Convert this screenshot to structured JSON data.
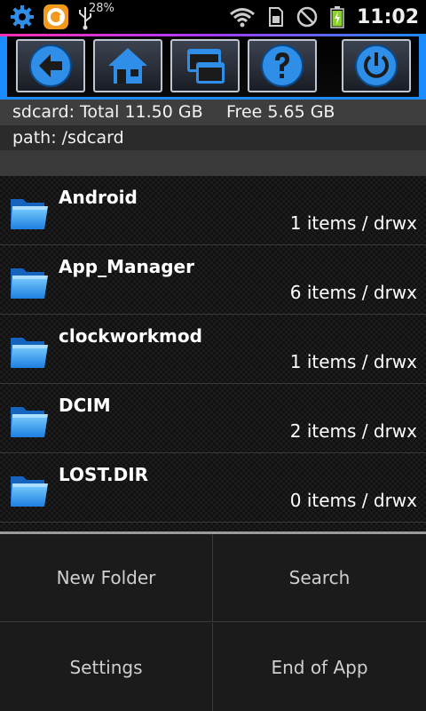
{
  "status_bar": {
    "battery_usb_percent": "28%",
    "time": "11:02",
    "icons": [
      "gear-icon",
      "app-icon",
      "usb-icon",
      "wifi-icon",
      "sim-icon",
      "no-signal-icon",
      "battery-charging-icon"
    ]
  },
  "toolbar": {
    "buttons": [
      "back-icon",
      "home-icon",
      "windows-icon",
      "help-icon",
      "power-icon"
    ],
    "accent_color": "#1a8cff"
  },
  "storage": {
    "total": "sdcard: Total 11.50 GB",
    "free": "Free 5.65 GB",
    "path": "path: /sdcard"
  },
  "files": [
    {
      "name": "Android",
      "meta": "1 items / drwx"
    },
    {
      "name": "App_Manager",
      "meta": "6 items / drwx"
    },
    {
      "name": "clockworkmod",
      "meta": "1 items / drwx"
    },
    {
      "name": "DCIM",
      "meta": "2 items / drwx"
    },
    {
      "name": "LOST.DIR",
      "meta": "0 items / drwx"
    }
  ],
  "menu": {
    "new_folder": "New Folder",
    "search": "Search",
    "settings": "Settings",
    "end_of_app": "End of App"
  }
}
